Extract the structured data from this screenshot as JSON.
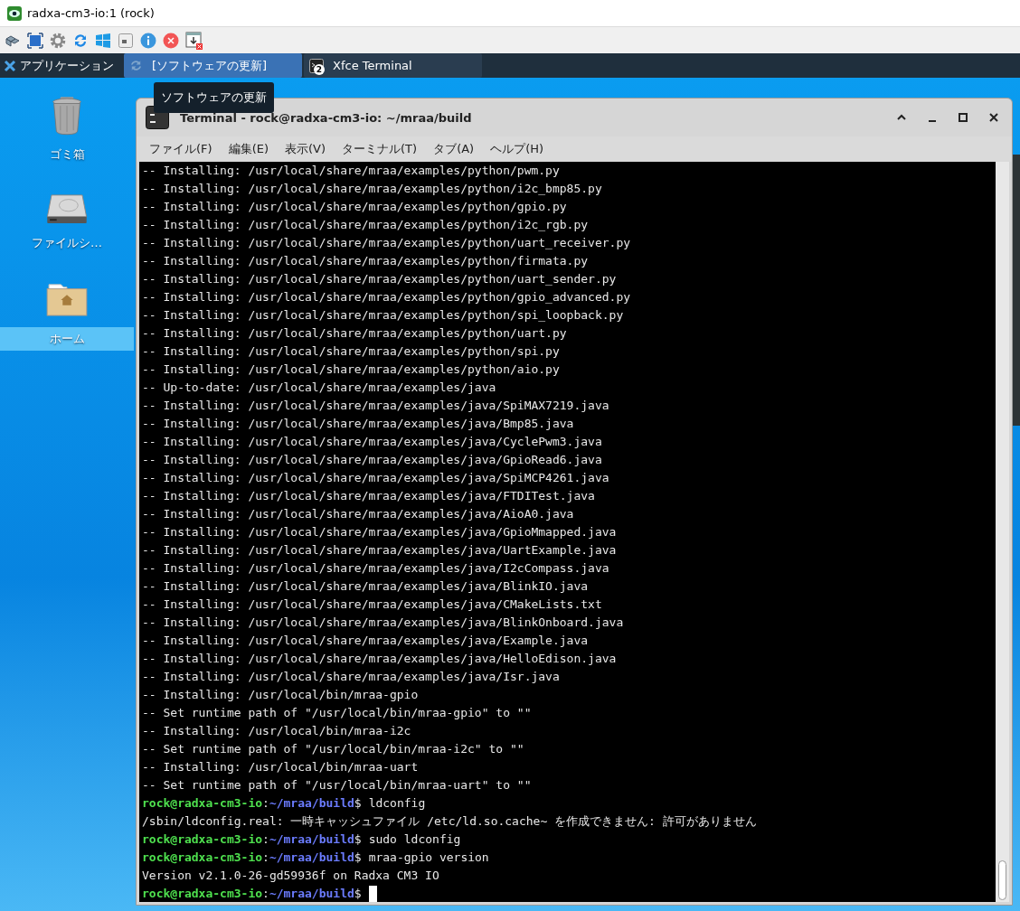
{
  "window": {
    "title": "radxa-cm3-io:1 (rock)"
  },
  "toolbar": {
    "buttons": [
      {
        "kind": "options"
      },
      {
        "kind": "fullscreen"
      },
      {
        "kind": "settings"
      },
      {
        "kind": "refresh"
      },
      {
        "kind": "windows"
      },
      {
        "kind": "keyboard"
      },
      {
        "kind": "info"
      },
      {
        "kind": "close"
      },
      {
        "kind": "transfer"
      }
    ]
  },
  "panel": {
    "apps_menu": "アプリケーション",
    "tasks": [
      {
        "label": "[ソフトウェアの更新]",
        "kind": "update",
        "selected": true
      },
      {
        "label": "Xfce Terminal",
        "kind": "terminal",
        "badge": "2",
        "selected": false
      }
    ],
    "tooltip": "ソフトウェアの更新"
  },
  "desktop": {
    "icons": [
      {
        "label": "ゴミ箱",
        "kind": "trash",
        "selected": false
      },
      {
        "label": "ファイルシ…",
        "kind": "drive",
        "selected": false
      },
      {
        "label": "ホーム",
        "kind": "home",
        "selected": true
      }
    ]
  },
  "terminal": {
    "title": "Terminal - rock@radxa-cm3-io: ~/mraa/build",
    "menu": [
      "ファイル(F)",
      "編集(E)",
      "表示(V)",
      "ターミナル(T)",
      "タブ(A)",
      "ヘルプ(H)"
    ],
    "lines": [
      {
        "kind": "output",
        "text": "-- Installing: /usr/local/share/mraa/examples/python/pwm.py"
      },
      {
        "kind": "output",
        "text": "-- Installing: /usr/local/share/mraa/examples/python/i2c_bmp85.py"
      },
      {
        "kind": "output",
        "text": "-- Installing: /usr/local/share/mraa/examples/python/gpio.py"
      },
      {
        "kind": "output",
        "text": "-- Installing: /usr/local/share/mraa/examples/python/i2c_rgb.py"
      },
      {
        "kind": "output",
        "text": "-- Installing: /usr/local/share/mraa/examples/python/uart_receiver.py"
      },
      {
        "kind": "output",
        "text": "-- Installing: /usr/local/share/mraa/examples/python/firmata.py"
      },
      {
        "kind": "output",
        "text": "-- Installing: /usr/local/share/mraa/examples/python/uart_sender.py"
      },
      {
        "kind": "output",
        "text": "-- Installing: /usr/local/share/mraa/examples/python/gpio_advanced.py"
      },
      {
        "kind": "output",
        "text": "-- Installing: /usr/local/share/mraa/examples/python/spi_loopback.py"
      },
      {
        "kind": "output",
        "text": "-- Installing: /usr/local/share/mraa/examples/python/uart.py"
      },
      {
        "kind": "output",
        "text": "-- Installing: /usr/local/share/mraa/examples/python/spi.py"
      },
      {
        "kind": "output",
        "text": "-- Installing: /usr/local/share/mraa/examples/python/aio.py"
      },
      {
        "kind": "output",
        "text": "-- Up-to-date: /usr/local/share/mraa/examples/java"
      },
      {
        "kind": "output",
        "text": "-- Installing: /usr/local/share/mraa/examples/java/SpiMAX7219.java"
      },
      {
        "kind": "output",
        "text": "-- Installing: /usr/local/share/mraa/examples/java/Bmp85.java"
      },
      {
        "kind": "output",
        "text": "-- Installing: /usr/local/share/mraa/examples/java/CyclePwm3.java"
      },
      {
        "kind": "output",
        "text": "-- Installing: /usr/local/share/mraa/examples/java/GpioRead6.java"
      },
      {
        "kind": "output",
        "text": "-- Installing: /usr/local/share/mraa/examples/java/SpiMCP4261.java"
      },
      {
        "kind": "output",
        "text": "-- Installing: /usr/local/share/mraa/examples/java/FTDITest.java"
      },
      {
        "kind": "output",
        "text": "-- Installing: /usr/local/share/mraa/examples/java/AioA0.java"
      },
      {
        "kind": "output",
        "text": "-- Installing: /usr/local/share/mraa/examples/java/GpioMmapped.java"
      },
      {
        "kind": "output",
        "text": "-- Installing: /usr/local/share/mraa/examples/java/UartExample.java"
      },
      {
        "kind": "output",
        "text": "-- Installing: /usr/local/share/mraa/examples/java/I2cCompass.java"
      },
      {
        "kind": "output",
        "text": "-- Installing: /usr/local/share/mraa/examples/java/BlinkIO.java"
      },
      {
        "kind": "output",
        "text": "-- Installing: /usr/local/share/mraa/examples/java/CMakeLists.txt"
      },
      {
        "kind": "output",
        "text": "-- Installing: /usr/local/share/mraa/examples/java/BlinkOnboard.java"
      },
      {
        "kind": "output",
        "text": "-- Installing: /usr/local/share/mraa/examples/java/Example.java"
      },
      {
        "kind": "output",
        "text": "-- Installing: /usr/local/share/mraa/examples/java/HelloEdison.java"
      },
      {
        "kind": "output",
        "text": "-- Installing: /usr/local/share/mraa/examples/java/Isr.java"
      },
      {
        "kind": "output",
        "text": "-- Installing: /usr/local/bin/mraa-gpio"
      },
      {
        "kind": "output",
        "text": "-- Set runtime path of \"/usr/local/bin/mraa-gpio\" to \"\""
      },
      {
        "kind": "output",
        "text": "-- Installing: /usr/local/bin/mraa-i2c"
      },
      {
        "kind": "output",
        "text": "-- Set runtime path of \"/usr/local/bin/mraa-i2c\" to \"\""
      },
      {
        "kind": "output",
        "text": "-- Installing: /usr/local/bin/mraa-uart"
      },
      {
        "kind": "output",
        "text": "-- Set runtime path of \"/usr/local/bin/mraa-uart\" to \"\""
      },
      {
        "kind": "prompt",
        "user": "rock@radxa-cm3-io",
        "sep": ":",
        "path": "~/mraa/build",
        "end": "$",
        "command": "ldconfig"
      },
      {
        "kind": "output",
        "text": "/sbin/ldconfig.real: 一時キャッシュファイル /etc/ld.so.cache~ を作成できません: 許可がありません"
      },
      {
        "kind": "prompt",
        "user": "rock@radxa-cm3-io",
        "sep": ":",
        "path": "~/mraa/build",
        "end": "$",
        "command": "sudo ldconfig"
      },
      {
        "kind": "prompt",
        "user": "rock@radxa-cm3-io",
        "sep": ":",
        "path": "~/mraa/build",
        "end": "$",
        "command": "mraa-gpio version"
      },
      {
        "kind": "output",
        "text": "Version v2.1.0-26-gd59936f on Radxa CM3 IO"
      },
      {
        "kind": "prompt",
        "user": "rock@radxa-cm3-io",
        "sep": ":",
        "path": "~/mraa/build",
        "end": "$",
        "cursor": true
      }
    ]
  }
}
